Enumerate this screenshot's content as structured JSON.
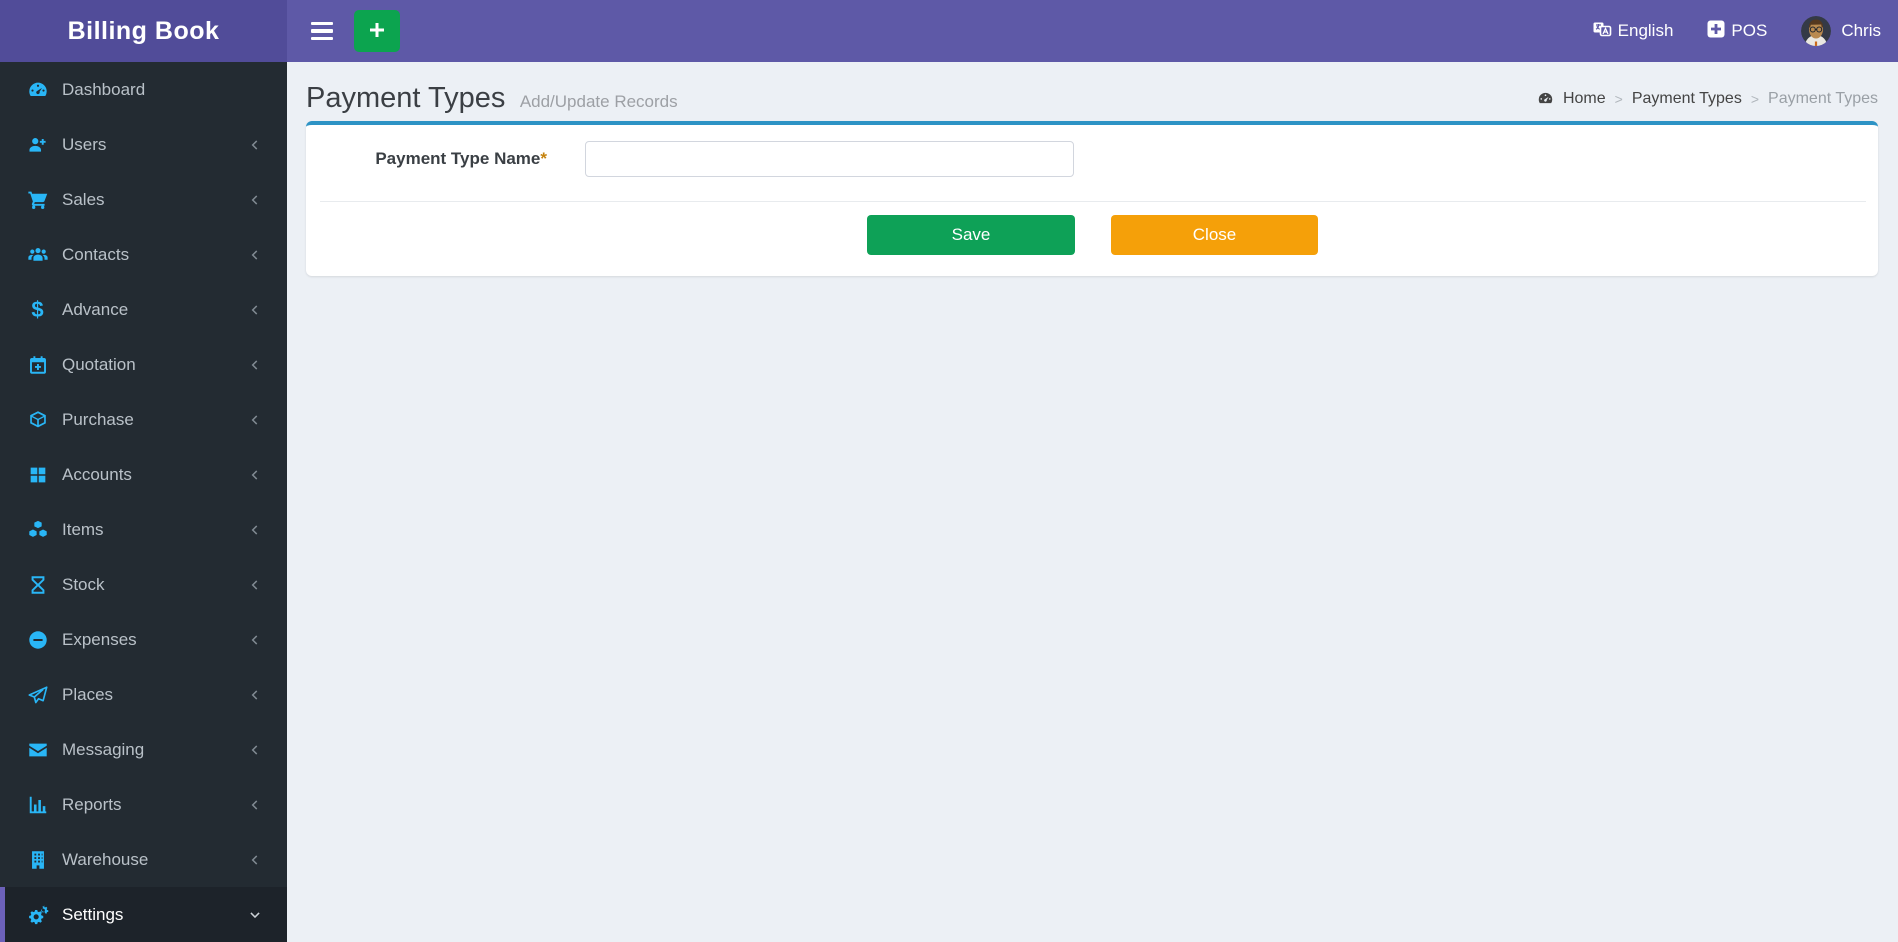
{
  "app": {
    "brand": "Billing Book"
  },
  "header": {
    "language": {
      "label": "English",
      "icon": "language-icon"
    },
    "pos": {
      "label": "POS",
      "icon": "plus-square-icon"
    },
    "user": {
      "name": "Chris",
      "icon": "avatar"
    }
  },
  "sidebar": {
    "items": [
      {
        "label": "Dashboard",
        "icon": "tachometer-icon",
        "has_submenu": false,
        "active": false
      },
      {
        "label": "Users",
        "icon": "user-plus-icon",
        "has_submenu": true,
        "active": false
      },
      {
        "label": "Sales",
        "icon": "cart-icon",
        "has_submenu": true,
        "active": false
      },
      {
        "label": "Contacts",
        "icon": "users-icon",
        "has_submenu": true,
        "active": false
      },
      {
        "label": "Advance",
        "icon": "dollar-icon",
        "has_submenu": true,
        "active": false
      },
      {
        "label": "Quotation",
        "icon": "calendar-plus-icon",
        "has_submenu": true,
        "active": false
      },
      {
        "label": "Purchase",
        "icon": "cube-icon",
        "has_submenu": true,
        "active": false
      },
      {
        "label": "Accounts",
        "icon": "grid-icon",
        "has_submenu": true,
        "active": false
      },
      {
        "label": "Items",
        "icon": "cubes-icon",
        "has_submenu": true,
        "active": false
      },
      {
        "label": "Stock",
        "icon": "hourglass-icon",
        "has_submenu": true,
        "active": false
      },
      {
        "label": "Expenses",
        "icon": "minus-circle-icon",
        "has_submenu": true,
        "active": false
      },
      {
        "label": "Places",
        "icon": "paper-plane-icon",
        "has_submenu": true,
        "active": false
      },
      {
        "label": "Messaging",
        "icon": "envelope-icon",
        "has_submenu": true,
        "active": false
      },
      {
        "label": "Reports",
        "icon": "bar-chart-icon",
        "has_submenu": true,
        "active": false
      },
      {
        "label": "Warehouse",
        "icon": "building-icon",
        "has_submenu": true,
        "active": false
      },
      {
        "label": "Settings",
        "icon": "gears-icon",
        "has_submenu": true,
        "active": true,
        "expanded": true
      }
    ]
  },
  "page": {
    "title": "Payment Types",
    "subtitle": "Add/Update Records",
    "breadcrumb": {
      "home": "Home",
      "section": "Payment Types",
      "current": "Payment Types",
      "separator": ">"
    }
  },
  "form": {
    "field_label": "Payment Type Name",
    "required_marker": "*",
    "input_value": "",
    "save_label": "Save",
    "close_label": "Close"
  },
  "colors": {
    "navbar_purple": "#5e59a7",
    "brand_purple": "#514c99",
    "sidebar_bg": "#232b32",
    "sidebar_active_bg": "#1d232a",
    "sidebar_active_border": "#6c61b9",
    "icon_cyan": "#29b6f6",
    "card_top_border": "#2d93c5",
    "save_green": "#0ea157",
    "close_orange": "#f5a009",
    "add_button_green": "#0ca44f",
    "content_bg": "#ecf0f5"
  }
}
